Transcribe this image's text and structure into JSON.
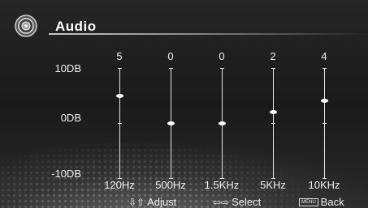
{
  "header": {
    "title": "Audio",
    "icon": "speaker-icon"
  },
  "scale": {
    "top_label": "10DB",
    "mid_label": "0DB",
    "bottom_label": "-10DB",
    "max": 10,
    "min": -10
  },
  "bands": [
    {
      "freq": "120Hz",
      "value_label": "5",
      "value": 5
    },
    {
      "freq": "500Hz",
      "value_label": "0",
      "value": 0
    },
    {
      "freq": "1.5KHz",
      "value_label": "0",
      "value": 0
    },
    {
      "freq": "5KHz",
      "value_label": "2",
      "value": 2
    },
    {
      "freq": "10KHz",
      "value_label": "4",
      "value": 4
    }
  ],
  "footer": {
    "adjust_label": "Adjust",
    "adjust_icon": "up-down-arrows-icon",
    "select_label": "Select",
    "select_icon": "left-right-arrows-icon",
    "menu_key": "MENU",
    "back_label": "Back"
  }
}
